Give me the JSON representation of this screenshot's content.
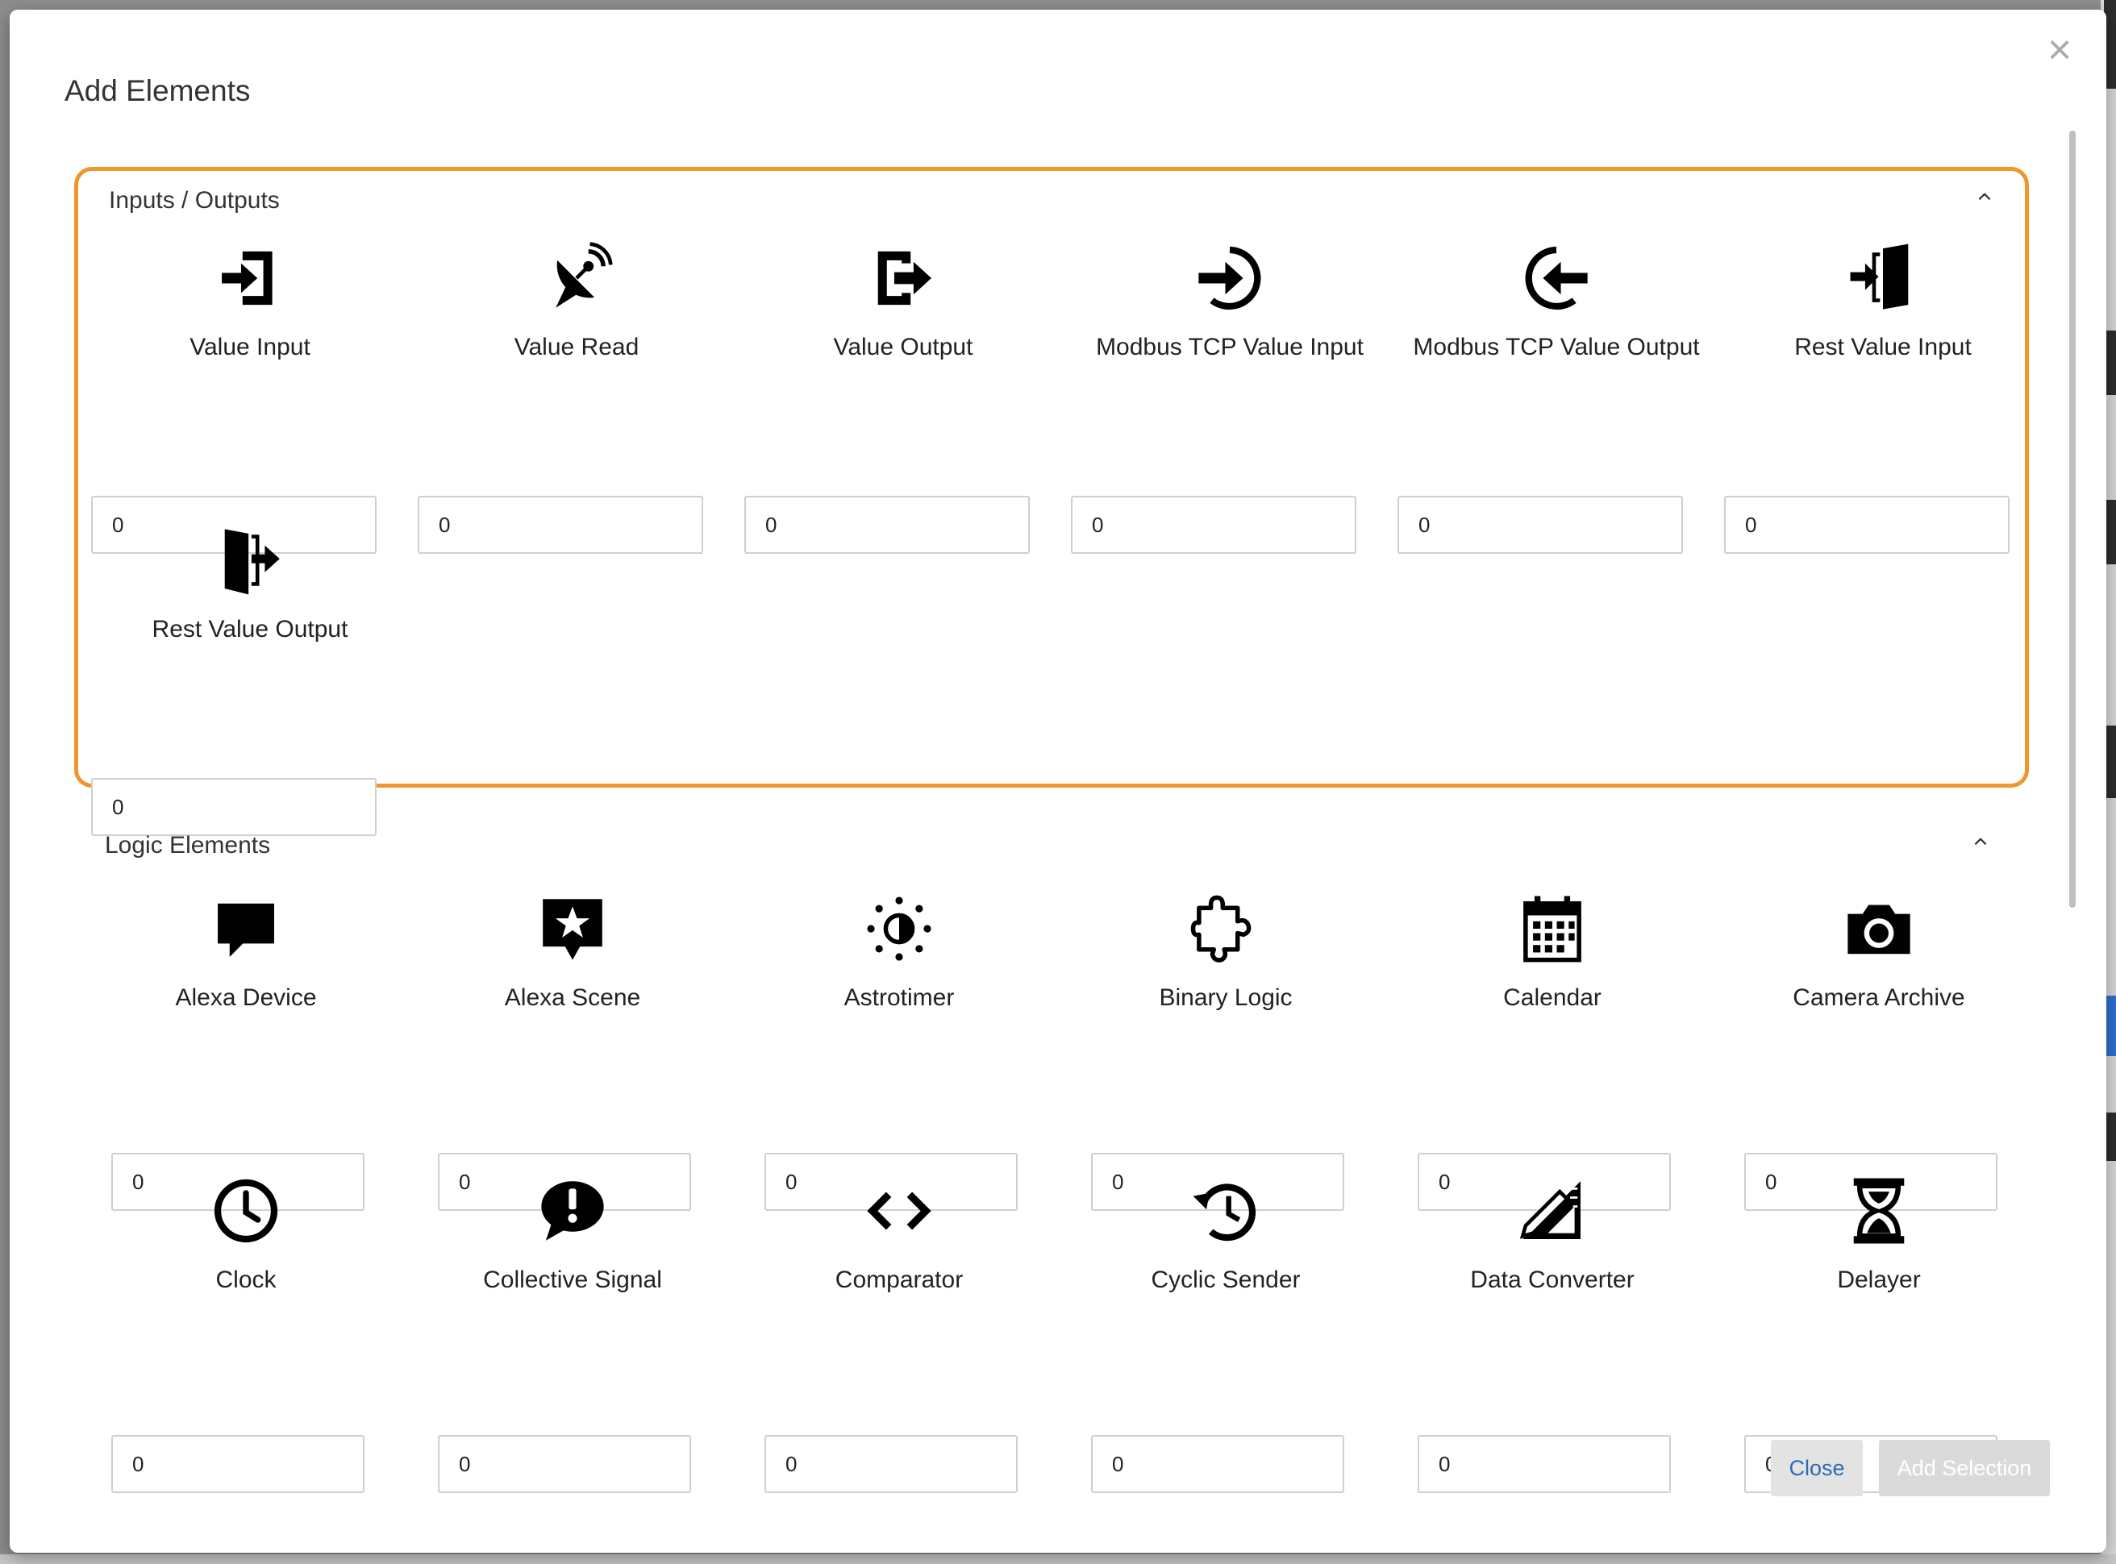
{
  "modal": {
    "title": "Add Elements",
    "close_symbol": "×"
  },
  "sections": {
    "io": {
      "title": "Inputs / Outputs",
      "items": [
        {
          "label": "Value Input",
          "icon": "sign-in-icon",
          "value": "0"
        },
        {
          "label": "Value Read",
          "icon": "satellite-dish-icon",
          "value": "0"
        },
        {
          "label": "Value Output",
          "icon": "sign-out-icon",
          "value": "0"
        },
        {
          "label": "Modbus TCP Value Input",
          "icon": "circle-arrow-in-icon",
          "value": "0"
        },
        {
          "label": "Modbus TCP Value Output",
          "icon": "circle-arrow-out-icon",
          "value": "0"
        },
        {
          "label": "Rest Value Input",
          "icon": "door-enter-icon",
          "value": "0"
        },
        {
          "label": "Rest Value Output",
          "icon": "door-exit-icon",
          "value": "0"
        }
      ]
    },
    "logic": {
      "title": "Logic Elements",
      "items": [
        {
          "label": "Alexa Device",
          "icon": "speech-bubble-icon",
          "value": "0"
        },
        {
          "label": "Alexa Scene",
          "icon": "star-bubble-icon",
          "value": "0"
        },
        {
          "label": "Astrotimer",
          "icon": "sun-moon-icon",
          "value": "0"
        },
        {
          "label": "Binary Logic",
          "icon": "puzzle-icon",
          "value": "0"
        },
        {
          "label": "Calendar",
          "icon": "calendar-icon",
          "value": "0"
        },
        {
          "label": "Camera Archive",
          "icon": "camera-icon",
          "value": "0"
        },
        {
          "label": "Clock",
          "icon": "clock-icon",
          "value": "0"
        },
        {
          "label": "Collective Signal",
          "icon": "alert-bubble-icon",
          "value": "0"
        },
        {
          "label": "Comparator",
          "icon": "code-icon",
          "value": "0"
        },
        {
          "label": "Cyclic Sender",
          "icon": "history-icon",
          "value": "0"
        },
        {
          "label": "Data Converter",
          "icon": "ruler-pencil-icon",
          "value": "0"
        },
        {
          "label": "Delayer",
          "icon": "hourglass-icon",
          "value": "0"
        }
      ]
    }
  },
  "footer": {
    "close_label": "Close",
    "add_label": "Add Selection"
  }
}
